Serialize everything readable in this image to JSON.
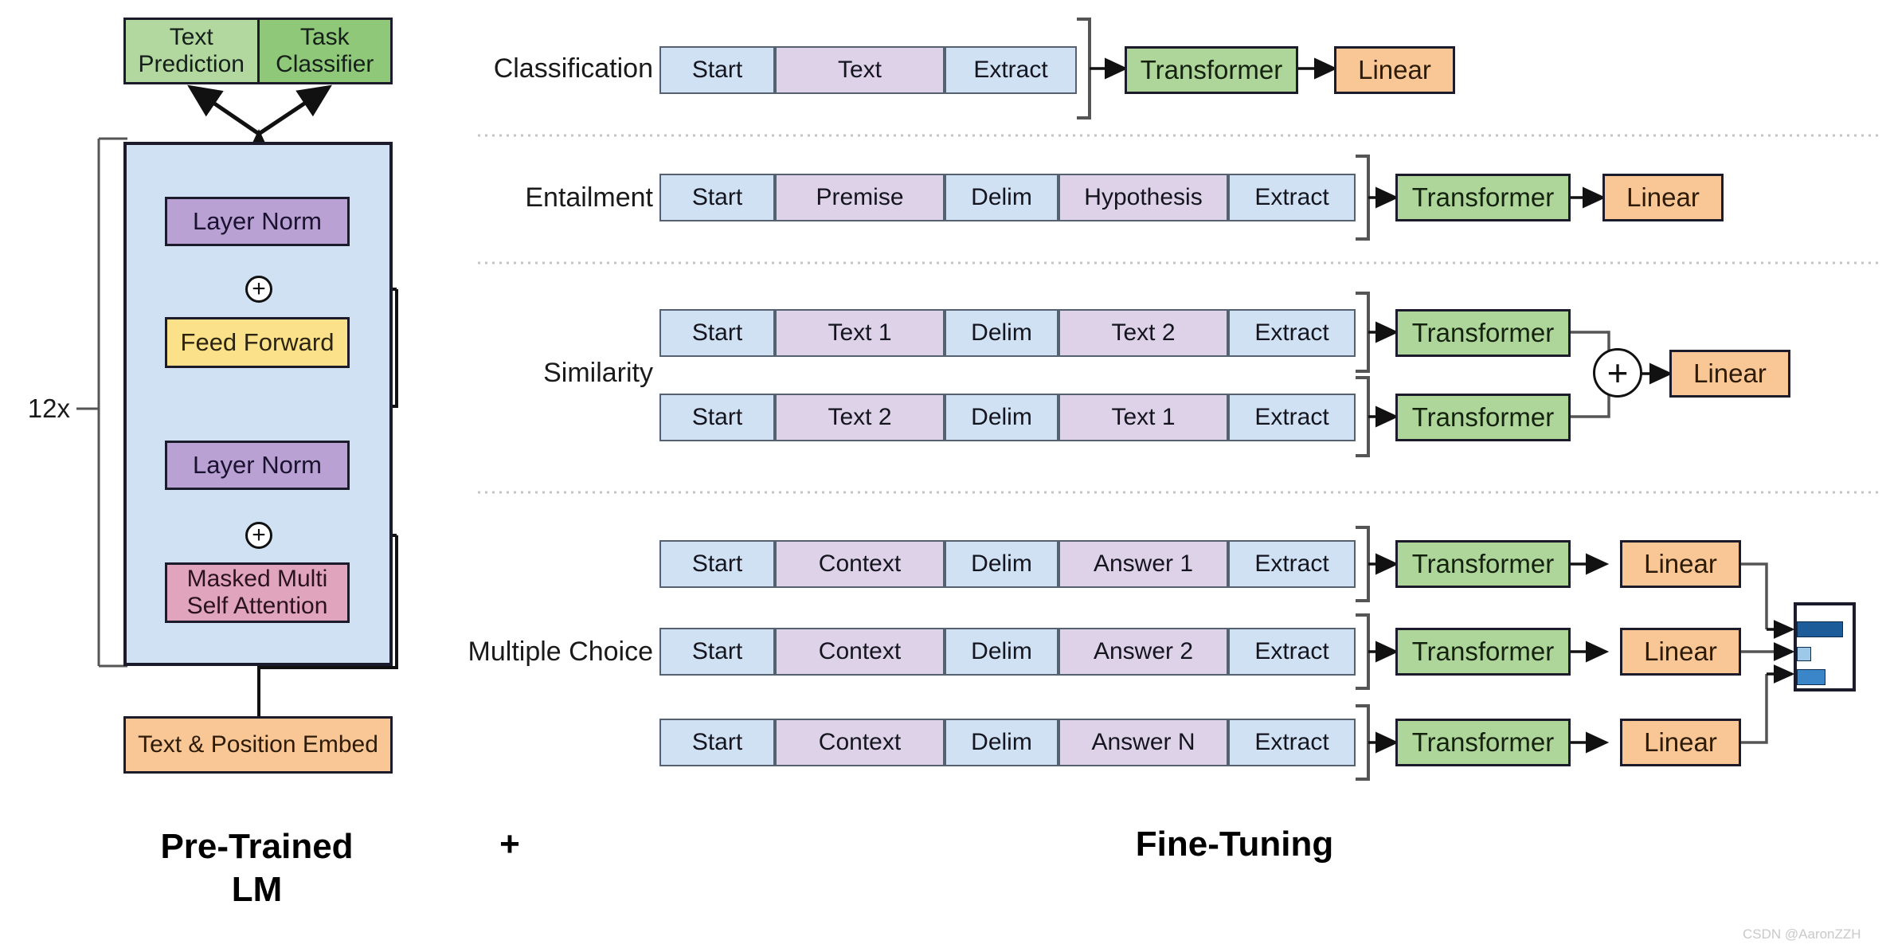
{
  "figure": {
    "title_left": "Pre-Trained\nLM",
    "plus_between": "+",
    "title_right": "Fine-Tuning",
    "watermark": "CSDN @AaronZZH"
  },
  "pretrained_lm": {
    "heads": {
      "text_prediction": "Text\nPrediction",
      "task_classifier": "Task\nClassifier"
    },
    "repeat_label": "12x",
    "blocks": [
      {
        "label": "Layer Norm",
        "color_class": "purple"
      },
      {
        "label": "Feed Forward",
        "color_class": "yellow"
      },
      {
        "label": "Layer Norm",
        "color_class": "purple"
      },
      {
        "label": "Masked Multi\nSelf Attention",
        "color_class": "pink"
      }
    ],
    "embedding": "Text & Position Embed",
    "residual_add_symbol": "+"
  },
  "fine_tuning": {
    "transformer_label": "Transformer",
    "linear_label": "Linear",
    "sum_symbol": "+",
    "tasks": [
      {
        "name": "Classification",
        "rows": [
          {
            "segments": [
              {
                "label": "Start",
                "type": "start"
              },
              {
                "label": "Text",
                "type": "text"
              },
              {
                "label": "Extract",
                "type": "extract"
              }
            ]
          }
        ]
      },
      {
        "name": "Entailment",
        "rows": [
          {
            "segments": [
              {
                "label": "Start",
                "type": "start"
              },
              {
                "label": "Premise",
                "type": "text"
              },
              {
                "label": "Delim",
                "type": "delim"
              },
              {
                "label": "Hypothesis",
                "type": "text"
              },
              {
                "label": "Extract",
                "type": "extract"
              }
            ]
          }
        ]
      },
      {
        "name": "Similarity",
        "rows": [
          {
            "segments": [
              {
                "label": "Start",
                "type": "start"
              },
              {
                "label": "Text 1",
                "type": "text"
              },
              {
                "label": "Delim",
                "type": "delim"
              },
              {
                "label": "Text 2",
                "type": "text"
              },
              {
                "label": "Extract",
                "type": "extract"
              }
            ]
          },
          {
            "segments": [
              {
                "label": "Start",
                "type": "start"
              },
              {
                "label": "Text 2",
                "type": "text"
              },
              {
                "label": "Delim",
                "type": "delim"
              },
              {
                "label": "Text 1",
                "type": "text"
              },
              {
                "label": "Extract",
                "type": "extract"
              }
            ]
          }
        ]
      },
      {
        "name": "Multiple Choice",
        "rows": [
          {
            "segments": [
              {
                "label": "Start",
                "type": "start"
              },
              {
                "label": "Context",
                "type": "text"
              },
              {
                "label": "Delim",
                "type": "delim"
              },
              {
                "label": "Answer 1",
                "type": "text"
              },
              {
                "label": "Extract",
                "type": "extract"
              }
            ]
          },
          {
            "segments": [
              {
                "label": "Start",
                "type": "start"
              },
              {
                "label": "Context",
                "type": "text"
              },
              {
                "label": "Delim",
                "type": "delim"
              },
              {
                "label": "Answer 2",
                "type": "text"
              },
              {
                "label": "Extract",
                "type": "extract"
              }
            ]
          },
          {
            "segments": [
              {
                "label": "Start",
                "type": "start"
              },
              {
                "label": "Context",
                "type": "text"
              },
              {
                "label": "Delim",
                "type": "delim"
              },
              {
                "label": "Answer N",
                "type": "text"
              },
              {
                "label": "Extract",
                "type": "extract"
              }
            ]
          }
        ]
      }
    ],
    "softmax_bars": [
      {
        "width_pct": 78,
        "color": "#1c5c99"
      },
      {
        "width_pct": 17,
        "color": "#9ec8e8"
      },
      {
        "width_pct": 42,
        "color": "#3a86c8"
      }
    ]
  },
  "colors": {
    "block_blue": "#cfe1f3",
    "segment_text": "#ddd2e8",
    "green": "#aed69a",
    "orange": "#f8c795",
    "purple": "#b9a1d4",
    "yellow": "#fbe28a",
    "pink": "#e0a5bd",
    "head_green_light": "#b2d8a0",
    "head_green_dark": "#8fc878"
  }
}
